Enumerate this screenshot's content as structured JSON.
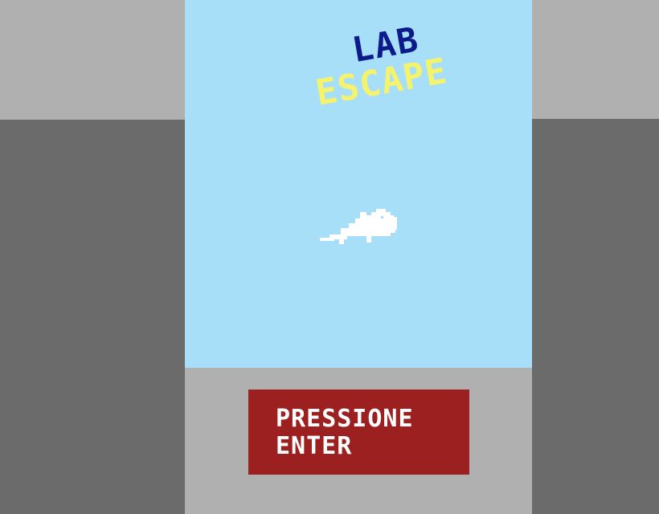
{
  "title": {
    "line1": "LAB",
    "line2": "ESCAPE"
  },
  "start_prompt": "PRESSIONE ENTER",
  "colors": {
    "sky": "#a7dff9",
    "ground": "#b0b0b0",
    "outer_dark": "#6b6b6b",
    "title_blue": "#0c1a8a",
    "title_yellow": "#f4f36b",
    "button_red": "#9d2020",
    "text_white": "#ffffff"
  },
  "sprites": {
    "player": "white-mouse"
  }
}
